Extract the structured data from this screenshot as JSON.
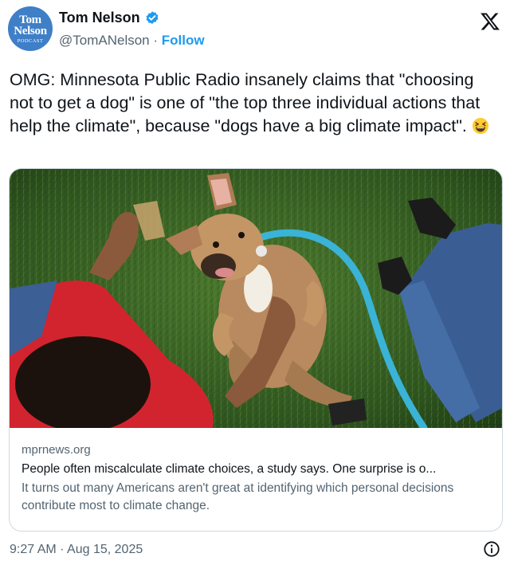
{
  "author": {
    "name": "Tom Nelson",
    "handle": "@TomANelson",
    "separator": "·",
    "follow_label": "Follow",
    "avatar_text": {
      "line1": "Tom",
      "line2": "Nelson",
      "line3": "PODCAST"
    },
    "avatar_color": "#3f7fc7",
    "verified_icon": "verified-badge-icon"
  },
  "tweet": {
    "text": "OMG: Minnesota Public Radio insanely claims that \"choosing not to get a dog\" is one of \"the top three individual actions that help the climate\", because \"dogs have a big climate impact\".",
    "emoji": "grinning-squinting-face-emoji"
  },
  "link_card": {
    "domain": "mprnews.org",
    "title": "People often miscalculate climate choices, a study says. One surprise is o...",
    "description": "It turns out many Americans aren't great at identifying which personal decisions contribute most to climate change.",
    "image": "photo-dog-on-grass"
  },
  "timestamp": "9:27 AM · Aug 15, 2025",
  "colors": {
    "accent": "#1d9bf0",
    "text_primary": "#0f1419",
    "text_secondary": "#536471",
    "border": "#cfd9de"
  }
}
